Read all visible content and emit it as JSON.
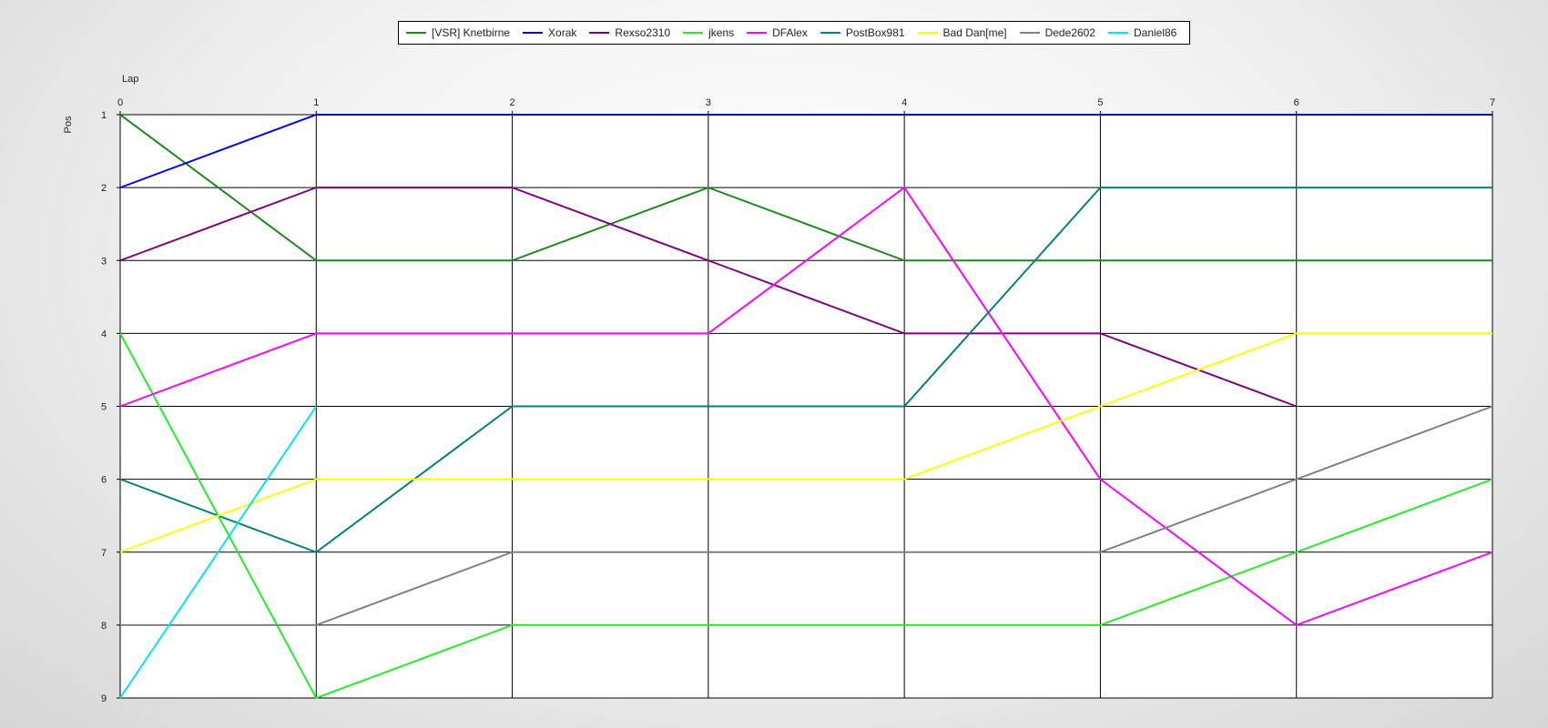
{
  "chart_data": {
    "type": "line",
    "x_title": "Lap",
    "y_title": "Pos",
    "x": [
      0,
      1,
      2,
      3,
      4,
      5,
      6,
      7
    ],
    "xlim": [
      0,
      7
    ],
    "ylim": [
      1,
      9
    ],
    "y_inverted": true,
    "y_ticks": [
      1,
      2,
      3,
      4,
      5,
      6,
      7,
      8,
      9
    ],
    "grid": true,
    "legend_position": "top",
    "series": [
      {
        "name": "[VSR] Knetbirne",
        "color": "#1a8a1a",
        "values": [
          1,
          3,
          3,
          2,
          3,
          3,
          3,
          3
        ]
      },
      {
        "name": "Xorak",
        "color": "#0000ff",
        "values": [
          2,
          1,
          1,
          1,
          1,
          1,
          1,
          1
        ]
      },
      {
        "name": "Rexso2310",
        "color": "#800080",
        "values": [
          3,
          2,
          2,
          3,
          4,
          4,
          5,
          null
        ]
      },
      {
        "name": "jkens",
        "color": "#22ee22",
        "values": [
          4,
          9,
          8,
          8,
          8,
          8,
          7,
          6
        ]
      },
      {
        "name": "DFAlex",
        "color": "#ff00ff",
        "values": [
          5,
          4,
          4,
          4,
          2,
          6,
          8,
          7
        ]
      },
      {
        "name": "PostBox981",
        "color": "#008080",
        "values": [
          6,
          7,
          5,
          5,
          5,
          2,
          2,
          2
        ]
      },
      {
        "name": "Bad Dan[me]",
        "color": "#ffff00",
        "values": [
          7,
          6,
          6,
          6,
          6,
          5,
          4,
          4
        ]
      },
      {
        "name": "Dede2602",
        "color": "#808080",
        "values": [
          8,
          8,
          7,
          7,
          7,
          7,
          6,
          5
        ]
      },
      {
        "name": "Daniel86",
        "color": "#00e5ee",
        "values": [
          9,
          5,
          null,
          null,
          null,
          null,
          null,
          null
        ]
      }
    ]
  }
}
